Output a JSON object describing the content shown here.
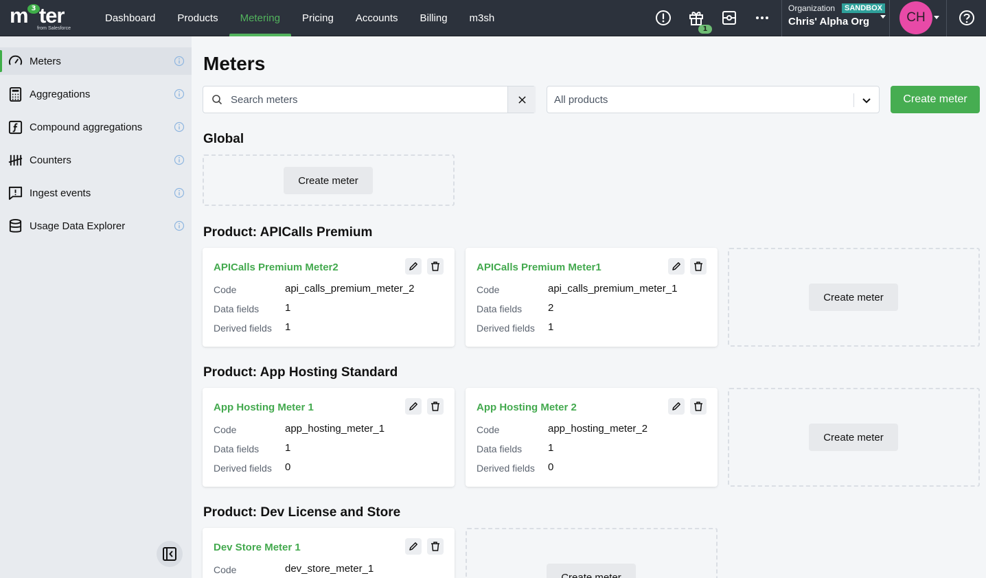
{
  "topbar": {
    "logo": {
      "text": "m3ter",
      "sup": "3",
      "sub": "from Salesforce"
    },
    "nav": [
      "Dashboard",
      "Products",
      "Metering",
      "Pricing",
      "Accounts",
      "Billing",
      "m3sh"
    ],
    "active_nav": "Metering",
    "gift_badge": "1",
    "org_label": "Organization",
    "org_badge": "SANDBOX",
    "org_name": "Chris' Alpha Org",
    "avatar": "CH",
    "colors": {
      "bg": "#2c323c",
      "accent": "#52b35d",
      "avatar": "#e84aa7",
      "sandbox": "#2fa19b"
    }
  },
  "sidebar": {
    "items": [
      {
        "label": "Meters",
        "icon": "gauge-icon",
        "active": true
      },
      {
        "label": "Aggregations",
        "icon": "calculator-icon"
      },
      {
        "label": "Compound aggregations",
        "icon": "function-icon"
      },
      {
        "label": "Counters",
        "icon": "tally-icon"
      },
      {
        "label": "Ingest events",
        "icon": "message-alert-icon"
      },
      {
        "label": "Usage Data Explorer",
        "icon": "database-icon"
      }
    ]
  },
  "main": {
    "title": "Meters",
    "search_placeholder": "Search meters",
    "product_filter": "All products",
    "create_button": "Create meter",
    "create_meter_label": "Create meter",
    "sections": [
      {
        "title": "Global",
        "meters": []
      },
      {
        "title": "Product: APICalls Premium",
        "meters": [
          {
            "name": "APICalls Premium Meter2",
            "code": "api_calls_premium_meter_2",
            "data_fields": "1",
            "derived_fields": "1"
          },
          {
            "name": "APICalls Premium Meter1",
            "code": "api_calls_premium_meter_1",
            "data_fields": "2",
            "derived_fields": "1"
          }
        ]
      },
      {
        "title": "Product: App Hosting Standard",
        "meters": [
          {
            "name": "App Hosting Meter 1",
            "code": "app_hosting_meter_1",
            "data_fields": "1",
            "derived_fields": "0"
          },
          {
            "name": "App Hosting Meter 2",
            "code": "app_hosting_meter_2",
            "data_fields": "1",
            "derived_fields": "0"
          }
        ]
      },
      {
        "title": "Product: Dev License and Store",
        "meters": [
          {
            "name": "Dev Store Meter 1",
            "code": "dev_store_meter_1"
          }
        ]
      }
    ],
    "labels": {
      "code": "Code",
      "data_fields": "Data fields",
      "derived_fields": "Derived fields"
    },
    "colors": {
      "primary": "#46ad51",
      "meter_title": "#43a94e"
    }
  }
}
